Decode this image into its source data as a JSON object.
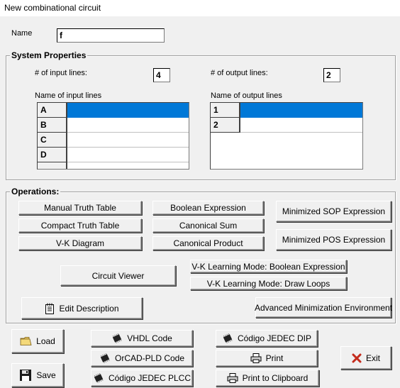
{
  "window": {
    "title": "New combinational circuit"
  },
  "name_field": {
    "label": "Name",
    "value": "f"
  },
  "system_properties": {
    "title": "System Properties",
    "input_lines_label": "# of input lines:",
    "input_lines_value": "4",
    "output_lines_label": "# of output lines:",
    "output_lines_value": "2",
    "input_names_label": "Name of input lines",
    "output_names_label": "Name of output lines",
    "input_lines": [
      "A",
      "B",
      "C",
      "D"
    ],
    "output_lines": [
      "1",
      "2"
    ]
  },
  "operations": {
    "title": "Operations:",
    "manual_truth_table": "Manual Truth Table",
    "compact_truth_table": "Compact Truth Table",
    "vk_diagram": "V-K Diagram",
    "boolean_expression": "Boolean Expression",
    "canonical_sum": "Canonical Sum",
    "canonical_product": "Canonical Product",
    "minimized_sop": "Minimized SOP Expression",
    "minimized_pos": "Minimized POS Expression",
    "circuit_viewer": "Circuit Viewer",
    "vk_learning_boolean": "V-K Learning Mode: Boolean Expression",
    "vk_learning_loops": "V-K Learning Mode: Draw Loops",
    "edit_description": "Edit Description",
    "advanced_minimization": "Advanced Minimization Environment"
  },
  "bottom": {
    "load": "Load",
    "save": "Save",
    "vhdl_code": "VHDL Code",
    "orcad_pld_code": "OrCAD-PLD Code",
    "jedec_plcc": "Código JEDEC PLCC",
    "jedec_dip": "Código JEDEC DIP",
    "print": "Print",
    "print_clipboard": "Print to Clipboard",
    "exit": "Exit"
  },
  "colors": {
    "selection": "#0078d7",
    "window_bg": "#f0f0f0",
    "exit_icon": "#c42b1c"
  },
  "icons": [
    "folder-icon",
    "floppy-disk-icon",
    "chip-icon",
    "printer-icon",
    "notepad-icon",
    "exit-x-icon"
  ]
}
